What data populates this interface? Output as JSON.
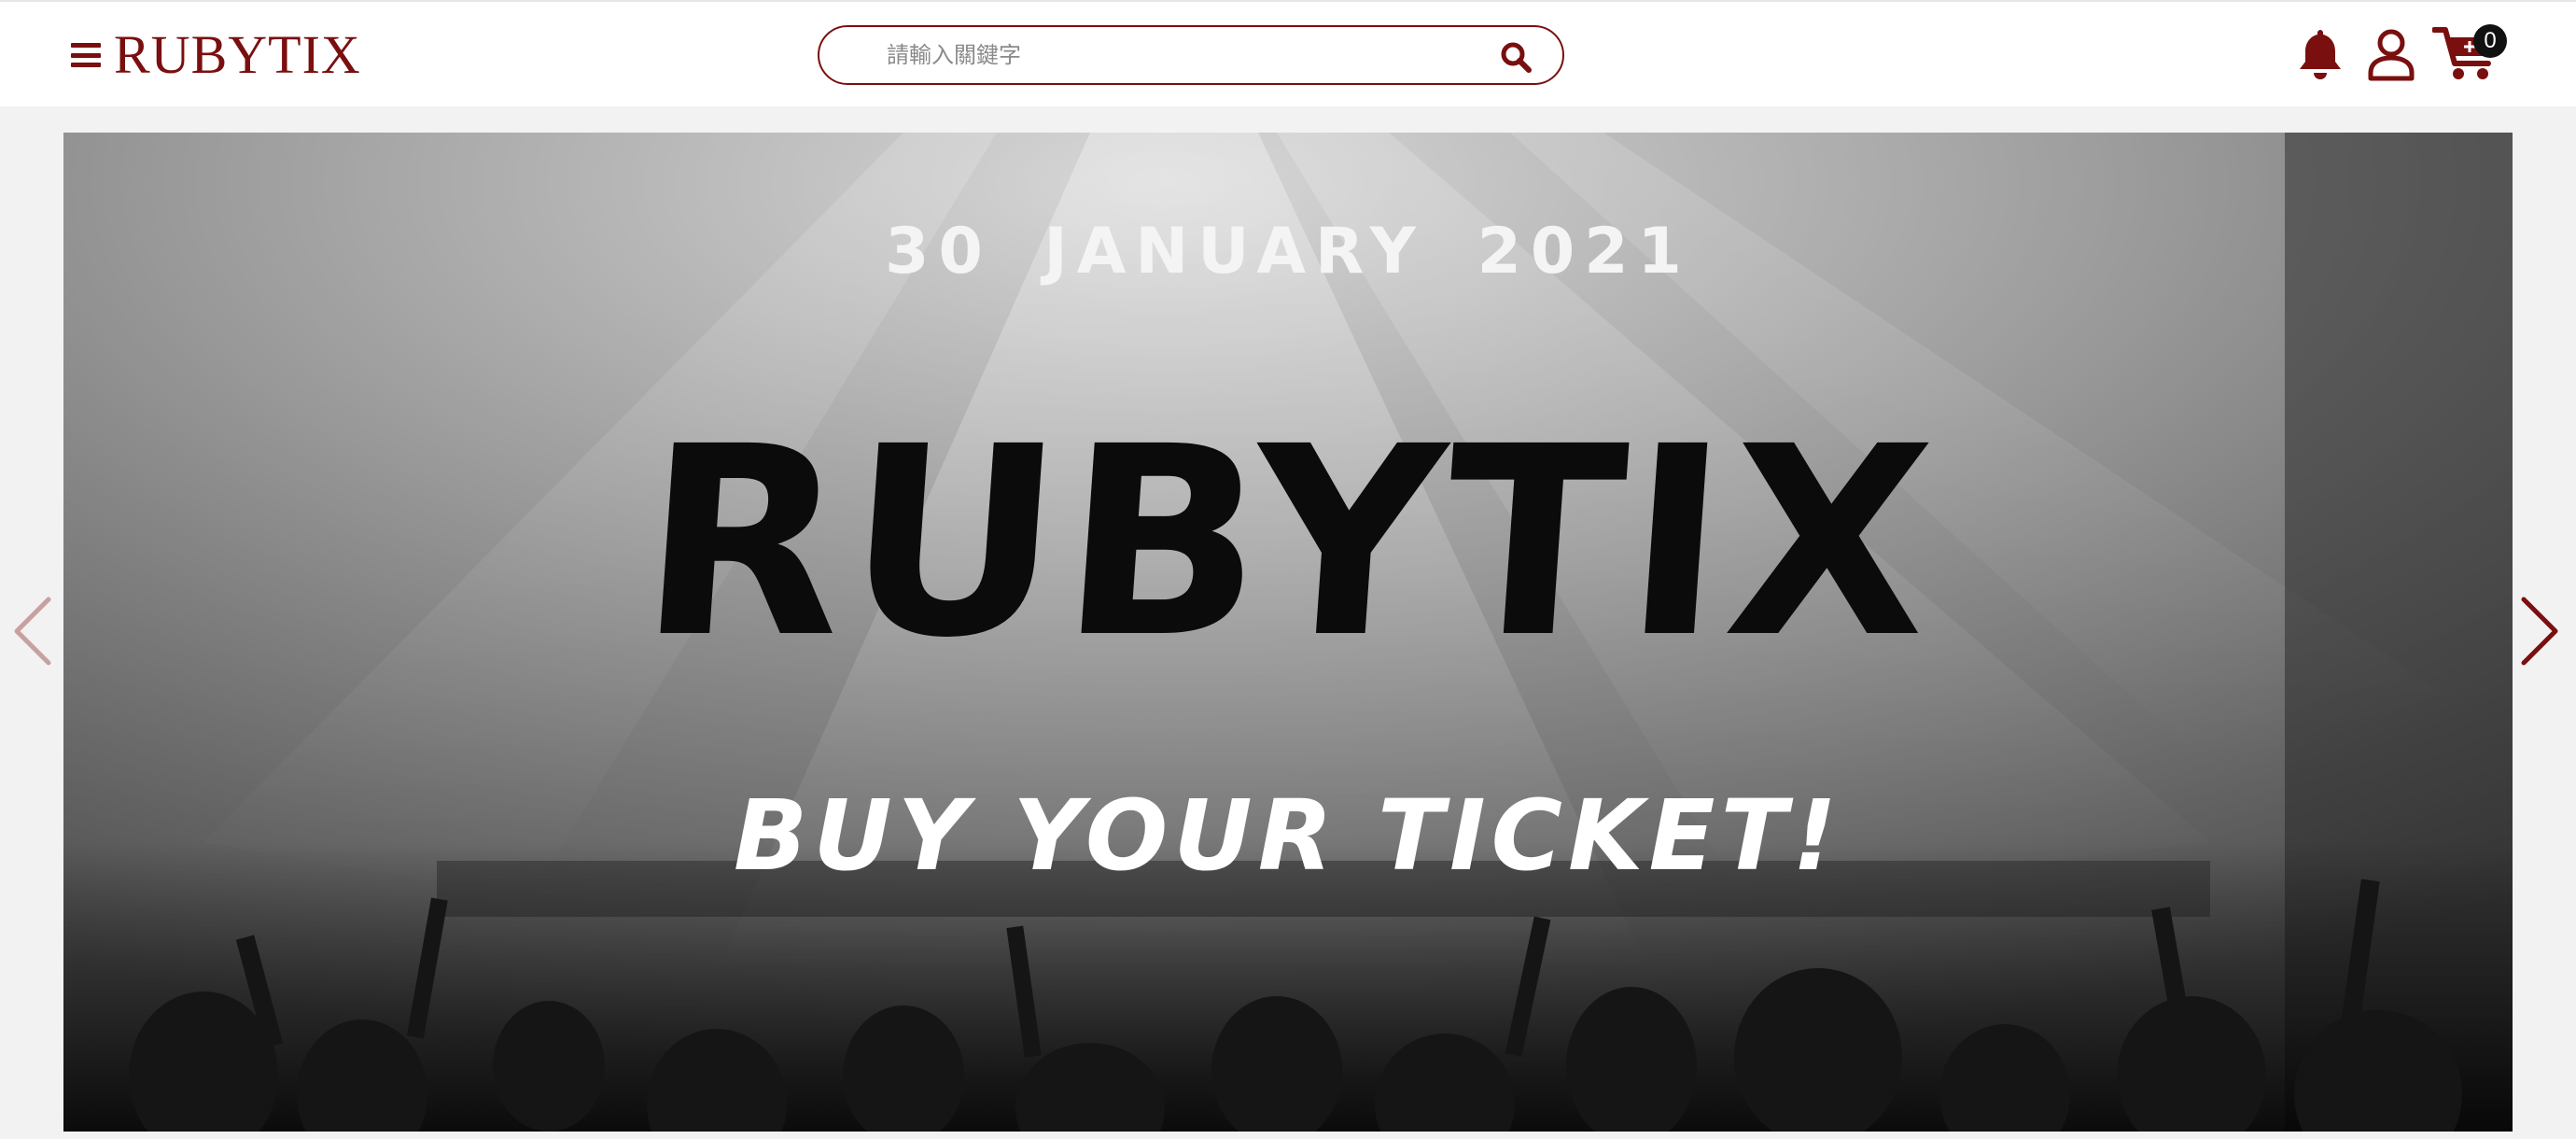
{
  "header": {
    "brand": "RUBYTIX",
    "search": {
      "placeholder": "請輸入關鍵字",
      "value": ""
    },
    "icons": [
      "menu-icon",
      "search-icon",
      "bell-icon",
      "user-icon",
      "cart-icon"
    ],
    "cart_count": "0"
  },
  "hero": {
    "date": "30 JANUARY 2021",
    "logo": "RUBYTIX",
    "cta": "BUY YOUR TICKET!"
  },
  "colors": {
    "brand": "#7a0f0f",
    "header_bg": "#ffffff",
    "page_bg": "#f2f2f2"
  }
}
